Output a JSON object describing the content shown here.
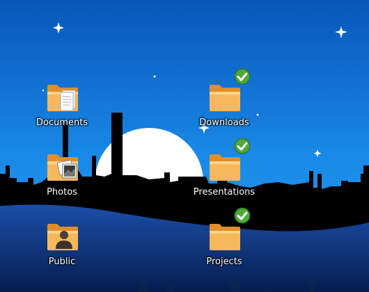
{
  "desktop": {
    "icons": [
      {
        "id": "documents",
        "label": "Documents",
        "overlay": "document-pages-icon",
        "emblem": null
      },
      {
        "id": "downloads",
        "label": "Downloads",
        "overlay": null,
        "emblem": "checkmark-emblem-icon"
      },
      {
        "id": "photos",
        "label": "Photos",
        "overlay": "photo-icon",
        "emblem": null
      },
      {
        "id": "presentations",
        "label": "Presentations",
        "overlay": null,
        "emblem": "checkmark-emblem-icon"
      },
      {
        "id": "public",
        "label": "Public",
        "overlay": "person-icon",
        "emblem": null
      },
      {
        "id": "projects",
        "label": "Projects",
        "overlay": null,
        "emblem": "checkmark-emblem-icon"
      }
    ]
  },
  "colors": {
    "sky_top": "#0a5fc0",
    "sky_mid": "#1a86e6",
    "folder_body": "#f3a94a",
    "folder_front": "#fbc874",
    "emblem_green": "#3f8f2e",
    "silhouette": "#000000",
    "water": "#0a2c6b"
  }
}
